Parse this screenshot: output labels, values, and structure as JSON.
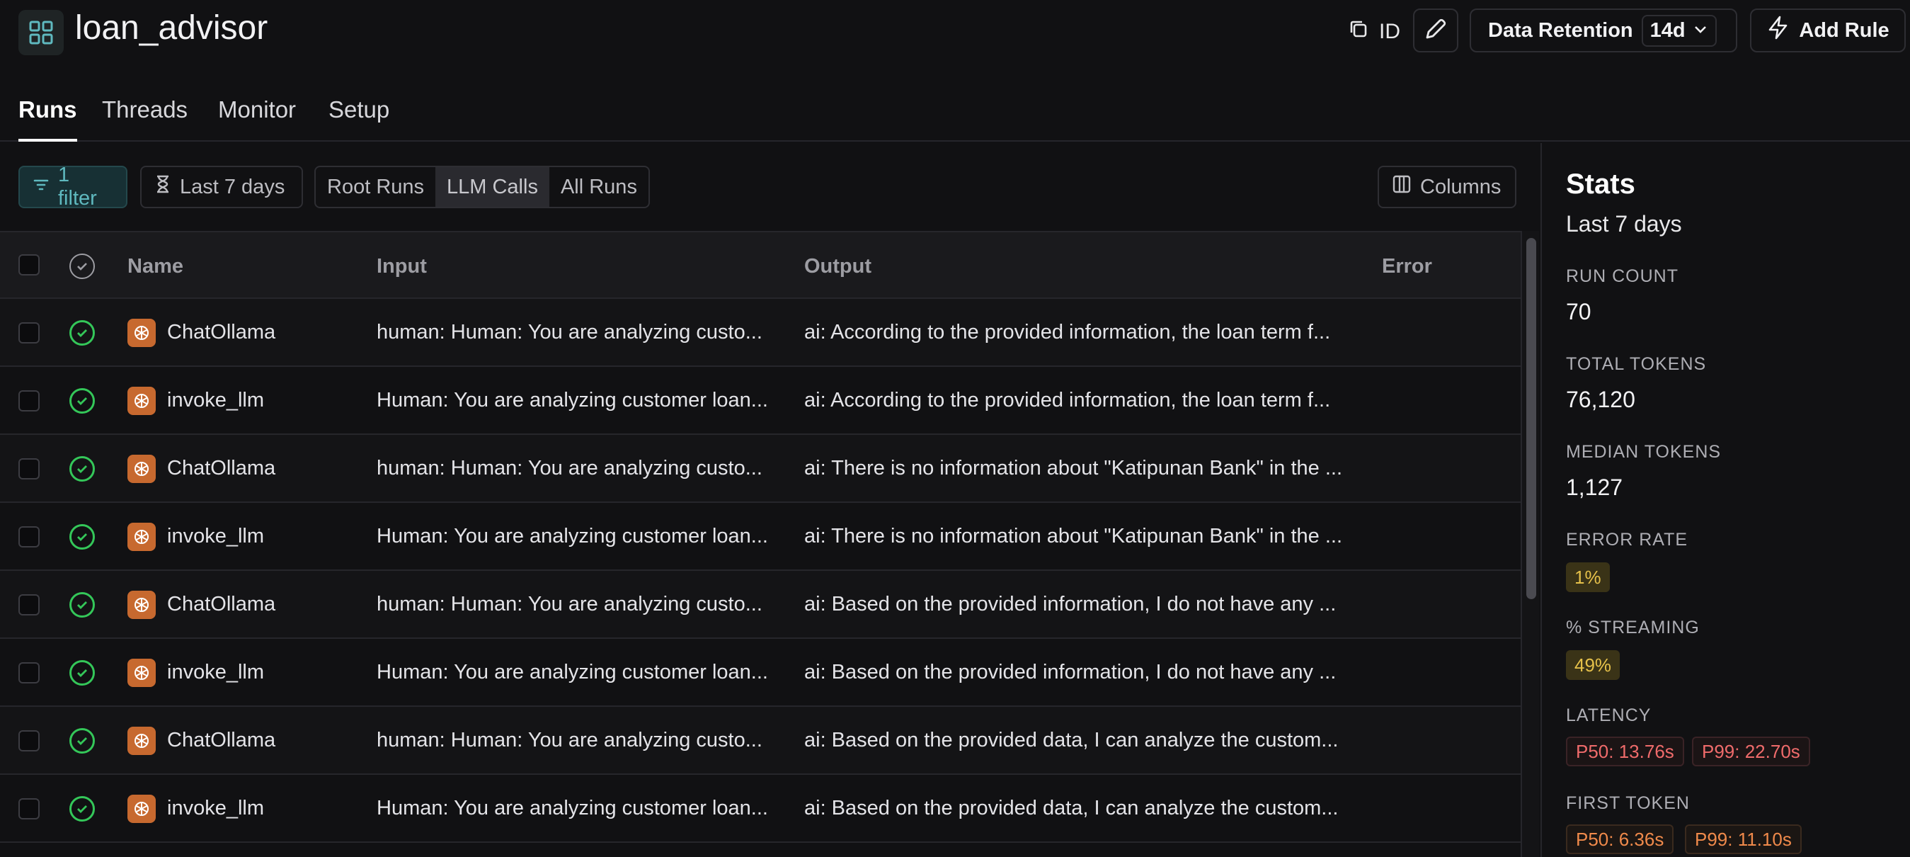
{
  "header": {
    "title": "loan_advisor",
    "id_label": "ID",
    "retention_label": "Data Retention",
    "retention_value": "14d",
    "add_rule_label": "Add Rule"
  },
  "tabs": [
    {
      "label": "Runs",
      "active": true
    },
    {
      "label": "Threads",
      "active": false
    },
    {
      "label": "Monitor",
      "active": false
    },
    {
      "label": "Setup",
      "active": false
    }
  ],
  "toolbar": {
    "filter_label": "1 filter",
    "date_label": "Last 7 days",
    "segments": [
      {
        "label": "Root Runs",
        "active": false
      },
      {
        "label": "LLM Calls",
        "active": true
      },
      {
        "label": "All Runs",
        "active": false
      }
    ],
    "columns_label": "Columns"
  },
  "table": {
    "columns": {
      "name": "Name",
      "input": "Input",
      "output": "Output",
      "error": "Error"
    },
    "rows": [
      {
        "name": "ChatOllama",
        "input": "human: Human: You are analyzing custo...",
        "output": "ai: According to the provided information, the loan term f...",
        "error": ""
      },
      {
        "name": "invoke_llm",
        "input": "Human: You are analyzing customer loan...",
        "output": "ai: According to the provided information, the loan term f...",
        "error": ""
      },
      {
        "name": "ChatOllama",
        "input": "human: Human: You are analyzing custo...",
        "output": "ai: There is no information about \"Katipunan Bank\" in the ...",
        "error": ""
      },
      {
        "name": "invoke_llm",
        "input": "Human: You are analyzing customer loan...",
        "output": "ai: There is no information about \"Katipunan Bank\" in the ...",
        "error": ""
      },
      {
        "name": "ChatOllama",
        "input": "human: Human: You are analyzing custo...",
        "output": "ai: Based on the provided information, I do not have any ...",
        "error": ""
      },
      {
        "name": "invoke_llm",
        "input": "Human: You are analyzing customer loan...",
        "output": "ai: Based on the provided information, I do not have any ...",
        "error": ""
      },
      {
        "name": "ChatOllama",
        "input": "human: Human: You are analyzing custo...",
        "output": "ai: Based on the provided data, I can analyze the custom...",
        "error": ""
      },
      {
        "name": "invoke_llm",
        "input": "Human: You are analyzing customer loan...",
        "output": "ai: Based on the provided data, I can analyze the custom...",
        "error": ""
      }
    ]
  },
  "stats": {
    "title": "Stats",
    "range": "Last 7 days",
    "run_count_label": "RUN COUNT",
    "run_count": "70",
    "total_tokens_label": "TOTAL TOKENS",
    "total_tokens": "76,120",
    "median_tokens_label": "MEDIAN TOKENS",
    "median_tokens": "1,127",
    "error_rate_label": "ERROR RATE",
    "error_rate": "1%",
    "streaming_label": "% STREAMING",
    "streaming": "49%",
    "latency_label": "LATENCY",
    "latency_p50": "P50: 13.76s",
    "latency_p99": "P99: 22.70s",
    "first_token_label": "FIRST TOKEN",
    "first_token_p50": "P50: 6.36s",
    "first_token_p99": "P99: 11.10s"
  },
  "colors": {
    "accent_teal": "#5fb9bf",
    "success_green": "#34c759",
    "run_icon_orange": "#c7692f",
    "warn_yellow": "#e6c14a",
    "latency_red": "#ef6b6b",
    "first_token_orange": "#f08a4b"
  }
}
